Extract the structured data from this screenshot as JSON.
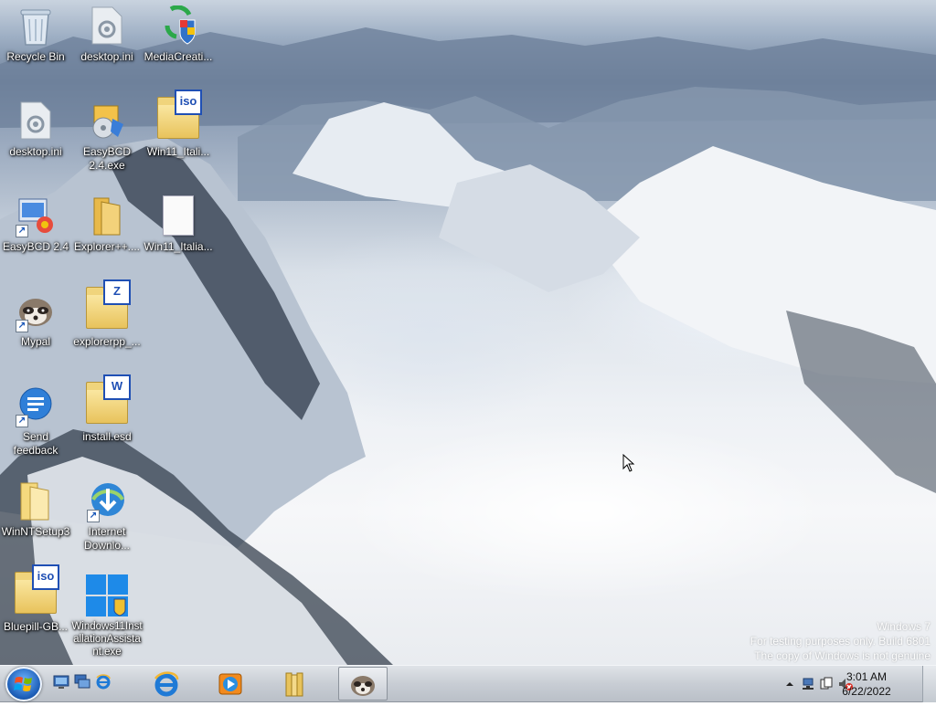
{
  "desktop": {
    "icons": [
      {
        "label": "Recycle Bin",
        "icon": "recycle-bin-icon"
      },
      {
        "label": "desktop.ini",
        "icon": "settings-file-icon"
      },
      {
        "label": "MediaCreati...",
        "icon": "media-creation-tool-icon"
      },
      {
        "label": "desktop.ini",
        "icon": "settings-file-icon"
      },
      {
        "label": "EasyBCD 2.4.exe",
        "icon": "installer-icon"
      },
      {
        "label": "Win11_Itali...",
        "icon": "iso-file-icon"
      },
      {
        "label": "EasyBCD 2.4",
        "icon": "easybcd-icon"
      },
      {
        "label": "Explorer++....",
        "icon": "folder-icon"
      },
      {
        "label": "Win11_Italia...",
        "icon": "blank-file-icon"
      },
      {
        "label": "Mypal",
        "icon": "raccoon-browser-icon"
      },
      {
        "label": "explorerpp_...",
        "icon": "zip-archive-icon"
      },
      {
        "label": "Send feedback",
        "icon": "feedback-icon"
      },
      {
        "label": "install.esd",
        "icon": "word-file-icon"
      },
      {
        "label": "WinNTSetup3",
        "icon": "folder-icon"
      },
      {
        "label": "Internet Downlo...",
        "icon": "internet-download-manager-icon"
      },
      {
        "label": "Bluepill-GB...",
        "icon": "iso-file-icon"
      },
      {
        "label": "Windows11InstallationAssistant.exe",
        "icon": "windows-logo-icon"
      }
    ],
    "watermark": {
      "line1": "Windows 7",
      "line2": "For testing purposes only. Build 6801",
      "line3": "The copy of Windows is not genuine"
    }
  },
  "taskbar": {
    "start_icon": "windows-orb-icon",
    "quick_launch": [
      "show-desktop-icon",
      "switch-windows-icon",
      "internet-explorer-small-icon"
    ],
    "pinned": [
      "internet-explorer-icon",
      "media-player-icon",
      "library-folder-icon",
      "mypal-taskbar-icon"
    ],
    "tray_icons": [
      "show-hidden-icons-chevron",
      "network-icon",
      "action-center-icon",
      "volume-muted-icon"
    ],
    "clock": {
      "time": "3:01 AM",
      "date": "6/22/2022"
    }
  },
  "colors": {
    "taskbar": "#c8cdd4",
    "folder": "#e8c35c",
    "badge_blue": "#1f4fb4"
  }
}
